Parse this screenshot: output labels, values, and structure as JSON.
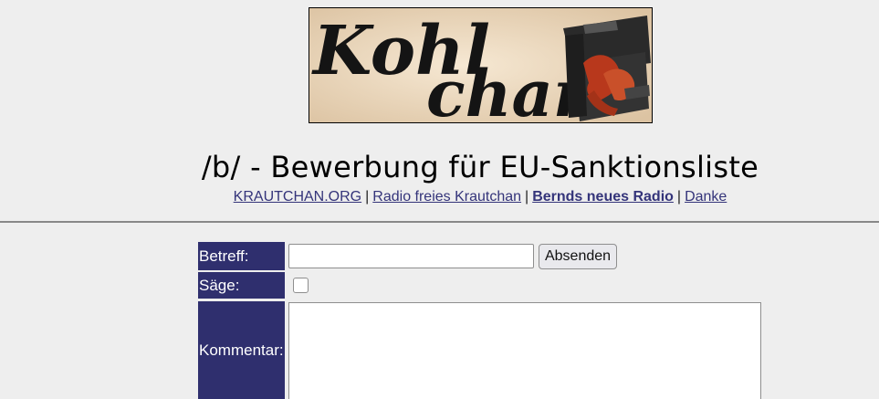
{
  "banner": {
    "logo_line1": "Kohl",
    "logo_line2": "chan",
    "banner_bg": "#eedbc2"
  },
  "board": {
    "title": "/b/ - Bewerbung für EU-Sanktionsliste"
  },
  "nav_links": [
    {
      "label": "KRAUTCHAN.ORG",
      "bold": false
    },
    {
      "label": "Radio freies Krautchan",
      "bold": false
    },
    {
      "label": "Bernds neues Radio",
      "bold": true
    },
    {
      "label": "Danke",
      "bold": false
    }
  ],
  "nav_separator": "|",
  "form": {
    "subject_label": "Betreff:",
    "subject_value": "",
    "submit_label": "Absenden",
    "sage_label": "Säge:",
    "sage_checked": false,
    "comment_label": "Kommentar:",
    "comment_value": ""
  },
  "colors": {
    "label_bg": "#2f2f6e",
    "label_text": "#ffffff",
    "link": "#34347a",
    "page_bg": "#eeeeee"
  }
}
